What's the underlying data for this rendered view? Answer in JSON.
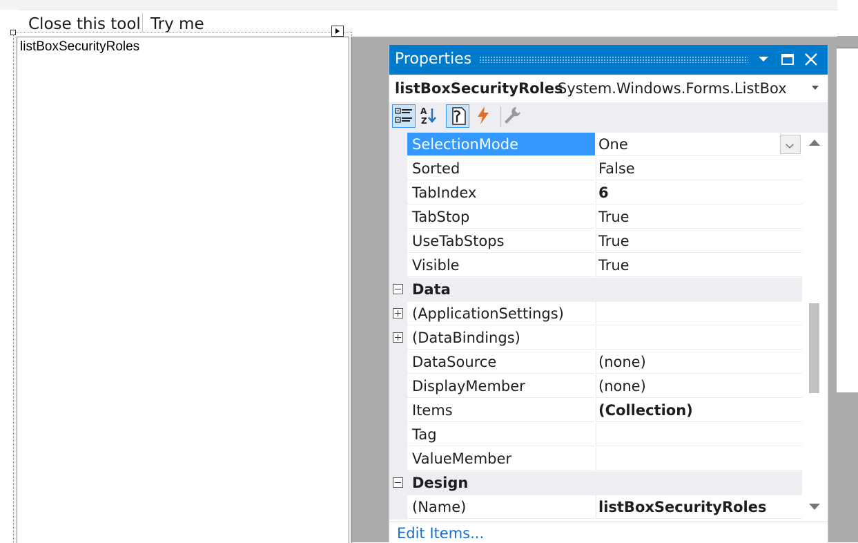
{
  "toolstrip": {
    "items": [
      {
        "label": "Close this tool"
      },
      {
        "label": "Try me"
      }
    ]
  },
  "listbox": {
    "text": "listBoxSecurityRoles"
  },
  "properties": {
    "title": "Properties",
    "title_icons": [
      "dropdown-arrow-icon",
      "maximize-icon",
      "close-icon"
    ],
    "object_name": "listBoxSecurityRoles",
    "object_type": "System.Windows.Forms.ListBox",
    "toolbar": [
      "categorized-icon",
      "alphabetical-icon",
      "properties-icon",
      "events-icon",
      "property-pages-icon"
    ],
    "rows": [
      {
        "kind": "prop",
        "name": "SelectionMode",
        "value": "One",
        "selected": true
      },
      {
        "kind": "prop",
        "name": "Sorted",
        "value": "False"
      },
      {
        "kind": "prop",
        "name": "TabIndex",
        "value": "6",
        "bold": true
      },
      {
        "kind": "prop",
        "name": "TabStop",
        "value": "True"
      },
      {
        "kind": "prop",
        "name": "UseTabStops",
        "value": "True"
      },
      {
        "kind": "prop",
        "name": "Visible",
        "value": "True"
      },
      {
        "kind": "category",
        "name": "Data"
      },
      {
        "kind": "prop",
        "name": "(ApplicationSettings)",
        "value": "",
        "expandable": true
      },
      {
        "kind": "prop",
        "name": "(DataBindings)",
        "value": "",
        "expandable": true
      },
      {
        "kind": "prop",
        "name": "DataSource",
        "value": "(none)"
      },
      {
        "kind": "prop",
        "name": "DisplayMember",
        "value": "(none)"
      },
      {
        "kind": "prop",
        "name": "Items",
        "value": "(Collection)",
        "bold": true
      },
      {
        "kind": "prop",
        "name": "Tag",
        "value": ""
      },
      {
        "kind": "prop",
        "name": "ValueMember",
        "value": ""
      },
      {
        "kind": "category",
        "name": "Design"
      },
      {
        "kind": "prop",
        "name": "(Name)",
        "value": "listBoxSecurityRoles",
        "bold": true
      }
    ],
    "commands_link": "Edit Items...",
    "colors": {
      "title_bar": "#007acc",
      "selection": "#3399ff",
      "link": "#1a6fc4"
    }
  }
}
